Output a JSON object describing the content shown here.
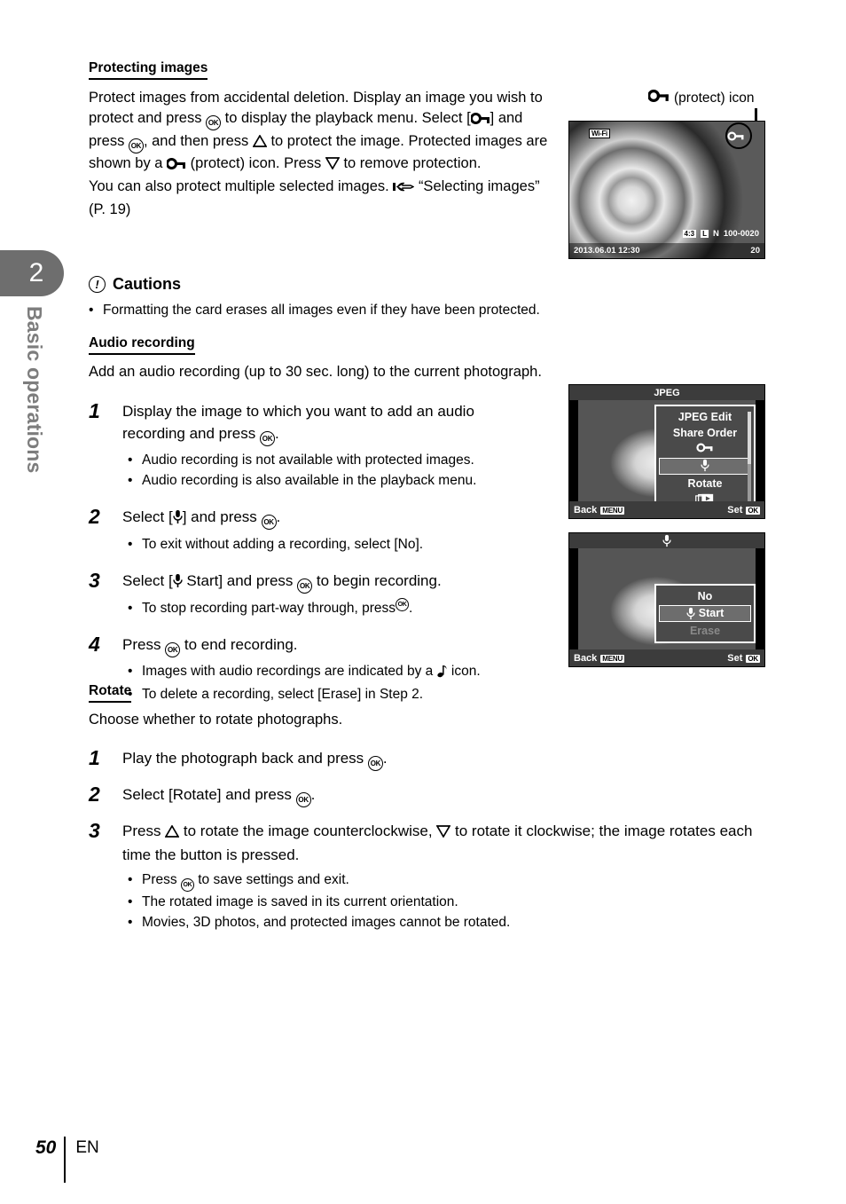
{
  "chapter": {
    "number": "2",
    "label": "Basic operations"
  },
  "sections": {
    "protecting": {
      "heading": "Protecting images",
      "paragraph_parts": {
        "p1": "Protect images from accidental deletion. Display an image you wish to protect and press ",
        "p2": " to display the playback menu. Select [",
        "p3": "] and press ",
        "p4": ", and then press ",
        "p5": " to protect the image. Protected images are shown by a ",
        "p6": " (protect) icon. Press ",
        "p7": " to remove protection.",
        "p8": "You can also protect multiple selected images. ",
        "p9": "“Selecting images” (P. 19)"
      }
    },
    "cautions": {
      "heading": "Cautions",
      "mark": "!",
      "items": [
        "Formatting the card erases all images even if they have been protected."
      ]
    },
    "audio": {
      "heading": "Audio recording",
      "intro": "Add an audio recording (up to 30 sec. long) to the current photograph.",
      "steps": [
        {
          "n": "1",
          "text_a": "Display the image to which you want to add an audio recording and press ",
          "text_b": ".",
          "subs": [
            "Audio recording is not available with protected images.",
            "Audio recording is also available in the playback menu."
          ]
        },
        {
          "n": "2",
          "text_a": "Select [",
          "text_b": "] and press ",
          "text_c": ".",
          "subs": [
            "To exit without adding a recording, select [No]."
          ]
        },
        {
          "n": "3",
          "text_a": "Select [",
          "text_b": " Start] and press ",
          "text_c": " to begin recording.",
          "subs_a": "To stop recording part-way through, press ",
          "subs_b": "."
        },
        {
          "n": "4",
          "text_a": "Press ",
          "text_b": " to end recording.",
          "sub1_a": "Images with audio recordings are indicated by a ",
          "sub1_b": " icon.",
          "sub2": "To delete a recording, select [Erase] in Step 2."
        }
      ]
    },
    "rotate": {
      "heading": "Rotate",
      "intro": "Choose whether to rotate photographs.",
      "steps": [
        {
          "n": "1",
          "text_a": "Play the photograph back and press ",
          "text_b": "."
        },
        {
          "n": "2",
          "text_a": "Select [Rotate] and press ",
          "text_b": "."
        },
        {
          "n": "3",
          "text_a": "Press ",
          "text_b": " to rotate the image counterclockwise, ",
          "text_c": " to rotate it clockwise; the image rotates each time the button is pressed.",
          "sub1_a": "Press ",
          "sub1_b": " to save settings and exit.",
          "sub2": "The rotated image is saved in its current orientation.",
          "sub3": "Movies, 3D photos, and protected images cannot be rotated."
        }
      ]
    }
  },
  "callout": {
    "label_suffix": "(protect) icon"
  },
  "screens": {
    "playback": {
      "wifi_badge": "Wi-Fi",
      "aspect": "4:3",
      "quality_l": "L",
      "quality_n": "N",
      "file_number": "100-0020",
      "datetime": "2013.06.01 12:30",
      "frame_number": "20"
    },
    "jpeg_menu": {
      "title": "JPEG",
      "items": [
        {
          "label": "JPEG Edit",
          "selected": false,
          "dim": false
        },
        {
          "label": "Share Order",
          "selected": false,
          "dim": false
        },
        {
          "label": "",
          "icon": "key-icon",
          "selected": false,
          "dim": false
        },
        {
          "label": "",
          "icon": "mic-icon",
          "selected": true,
          "dim": false
        },
        {
          "label": "Rotate",
          "selected": false,
          "dim": false
        },
        {
          "label": "",
          "icon": "playback-icon",
          "selected": false,
          "dim": false
        }
      ],
      "back_label": "Back",
      "back_badge": "MENU",
      "set_label": "Set",
      "set_badge": "OK"
    },
    "audio_menu": {
      "title_icon": "mic-icon",
      "items": [
        {
          "label": "No",
          "selected": false,
          "dim": false
        },
        {
          "label": "Start",
          "icon": "mic-icon",
          "selected": true,
          "dim": false
        },
        {
          "label": "Erase",
          "selected": false,
          "dim": true
        }
      ],
      "back_label": "Back",
      "back_badge": "MENU",
      "set_label": "Set",
      "set_badge": "OK"
    }
  },
  "footer": {
    "page": "50",
    "language": "EN"
  }
}
